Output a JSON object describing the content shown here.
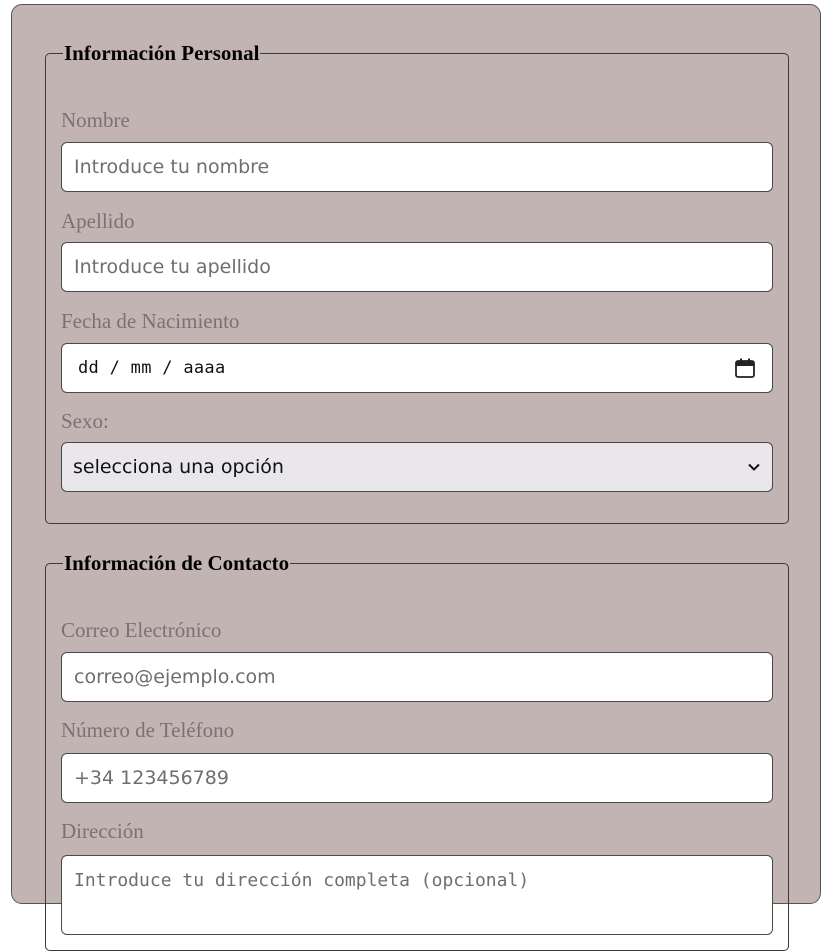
{
  "personal": {
    "legend": "Información Personal",
    "nombre": {
      "label": "Nombre",
      "placeholder": "Introduce tu nombre"
    },
    "apellido": {
      "label": "Apellido",
      "placeholder": "Introduce tu apellido"
    },
    "fecha": {
      "label": "Fecha de Nacimiento",
      "display": "dd / mm / aaaa",
      "icon": "calendar-icon"
    },
    "sexo": {
      "label": "Sexo:",
      "selected": "selecciona una opción",
      "icon": "chevron-down-icon"
    }
  },
  "contacto": {
    "legend": "Información de Contacto",
    "correo": {
      "label": "Correo Electrónico",
      "placeholder": "correo@ejemplo.com"
    },
    "telefono": {
      "label": "Número de Teléfono",
      "placeholder": "+34 123456789"
    },
    "direccion": {
      "label": "Dirección",
      "placeholder": "Introduce tu dirección completa (opcional)"
    }
  },
  "colors": {
    "form_background": "#c3b4b4",
    "label_text": "#7a7272",
    "select_background": "#e9e7ec"
  }
}
